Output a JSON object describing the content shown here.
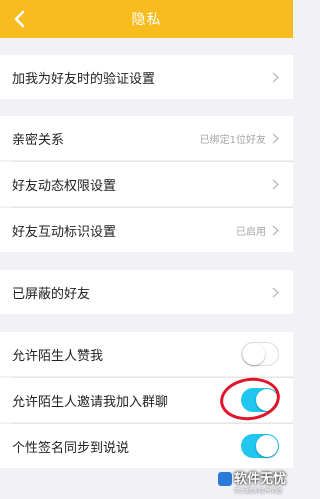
{
  "header": {
    "title": "隐私",
    "back_icon": "chevron-left-icon"
  },
  "rows": {
    "verify": {
      "label": "加我为好友时的验证设置"
    },
    "intimate": {
      "label": "亲密关系",
      "value": "已绑定1位好友"
    },
    "moments": {
      "label": "好友动态权限设置"
    },
    "interaction": {
      "label": "好友互动标识设置",
      "value": "已启用"
    },
    "blocked": {
      "label": "已屏蔽的好友"
    },
    "stranger_like": {
      "label": "允许陌生人赞我",
      "toggle_on": false
    },
    "stranger_invite": {
      "label": "允许陌生人邀请我加入群聊",
      "toggle_on": true
    },
    "signature_sync": {
      "label": "个性签名同步到说说",
      "toggle_on": true
    }
  },
  "watermark": {
    "title": "软件无忧",
    "subtitle": "努力解决软件问题"
  },
  "colors": {
    "header_bg": "#f8bc1e",
    "toggle_on": "#1ec6f0",
    "annotation_circle": "#e0142a"
  }
}
